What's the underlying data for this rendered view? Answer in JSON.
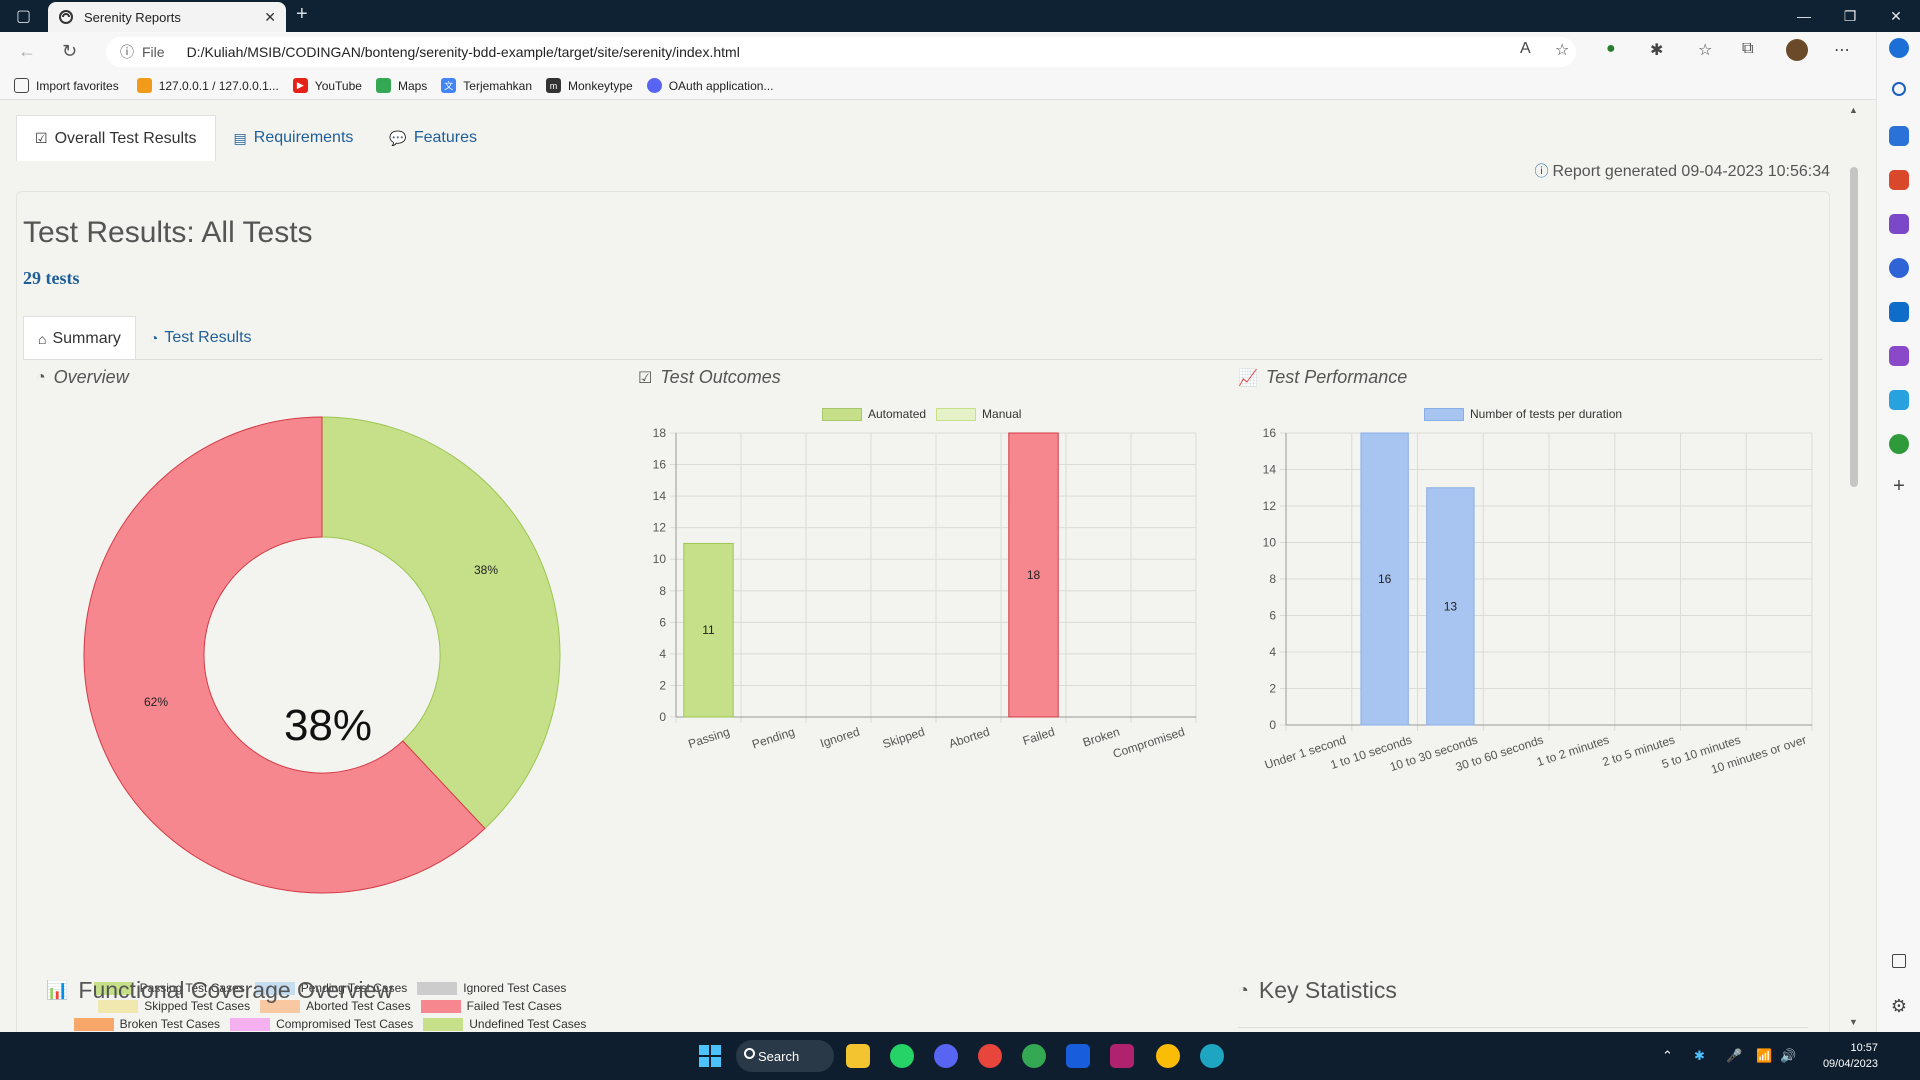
{
  "browser": {
    "tab_title": "Serenity Reports",
    "url_prefix": "File",
    "url": "D:/Kuliah/MSIB/CODINGAN/bonteng/serenity-bdd-example/target/site/serenity/index.html",
    "bookmarks": [
      "Import favorites",
      "127.0.0.1 / 127.0.0.1...",
      "YouTube",
      "Maps",
      "Terjemahkan",
      "Monkeytype",
      "OAuth application..."
    ]
  },
  "nav": {
    "tabs": [
      "Overall Test Results",
      "Requirements",
      "Features"
    ],
    "report_generated": "Report generated 09-04-2023 10:56:34"
  },
  "header": {
    "title": "Test Results: All Tests",
    "test_count": "29 tests"
  },
  "sub_tabs": [
    "Summary",
    "Test Results"
  ],
  "panels": {
    "overview": "Overview",
    "outcomes": "Test Outcomes",
    "performance": "Test Performance",
    "functional": "Functional Coverage Overview",
    "key_stats": "Key Statistics"
  },
  "chart_data": [
    {
      "type": "pie",
      "title": "Overview",
      "center_label": "38%",
      "slices": [
        {
          "name": "Passing Test Cases",
          "value": 38,
          "label": "38%"
        },
        {
          "name": "Failed Test Cases",
          "value": 62,
          "label": "62%"
        }
      ],
      "legend": [
        "Passing Test Cases",
        "Pending Test Cases",
        "Ignored Test Cases",
        "Skipped Test Cases",
        "Aborted Test Cases",
        "Failed Test Cases",
        "Broken Test Cases",
        "Compromised Test Cases",
        "Undefined Test Cases"
      ],
      "legend_colors": [
        "#c5e088",
        "#c6dcef",
        "#cccccc",
        "#f1e8b0",
        "#f8c8a3",
        "#f7878f",
        "#f9a66b",
        "#f5b0f0",
        "#c5e088"
      ],
      "colors": {
        "passing": "#c5e088",
        "failed": "#f7878f"
      }
    },
    {
      "type": "bar",
      "title": "Test Outcomes",
      "categories": [
        "Passing",
        "Pending",
        "Ignored",
        "Skipped",
        "Aborted",
        "Failed",
        "Broken",
        "Compromised"
      ],
      "series": [
        {
          "name": "Automated",
          "values": [
            11,
            0,
            0,
            0,
            0,
            18,
            0,
            0
          ]
        },
        {
          "name": "Manual",
          "values": [
            0,
            0,
            0,
            0,
            0,
            0,
            0,
            0
          ]
        }
      ],
      "bar_colors": [
        "#c5e088",
        "#c6dcef",
        "#cccccc",
        "#f1e8b0",
        "#f8c8a3",
        "#f7878f",
        "#f9a66b",
        "#f5b0f0"
      ],
      "yticks": [
        0,
        2,
        4,
        6,
        8,
        10,
        12,
        14,
        16,
        18
      ],
      "ylim": [
        0,
        18
      ],
      "grid": true,
      "legend_placement": "top"
    },
    {
      "type": "bar",
      "title": "Test Performance",
      "categories": [
        "Under 1 second",
        "1 to 10 seconds",
        "10 to 30 seconds",
        "30 to 60 seconds",
        "1 to 2 minutes",
        "2 to 5 minutes",
        "5 to 10 minutes",
        "10 minutes or over"
      ],
      "series": [
        {
          "name": "Number of tests per duration",
          "values": [
            0,
            16,
            13,
            0,
            0,
            0,
            0,
            0
          ]
        }
      ],
      "bar_color": "#a8c4f0",
      "yticks": [
        0,
        2,
        4,
        6,
        8,
        10,
        12,
        14,
        16
      ],
      "ylim": [
        0,
        16
      ],
      "grid": true,
      "legend_placement": "top"
    }
  ],
  "taskbar": {
    "search_label": "Search",
    "time": "10:57",
    "date": "09/04/2023"
  }
}
